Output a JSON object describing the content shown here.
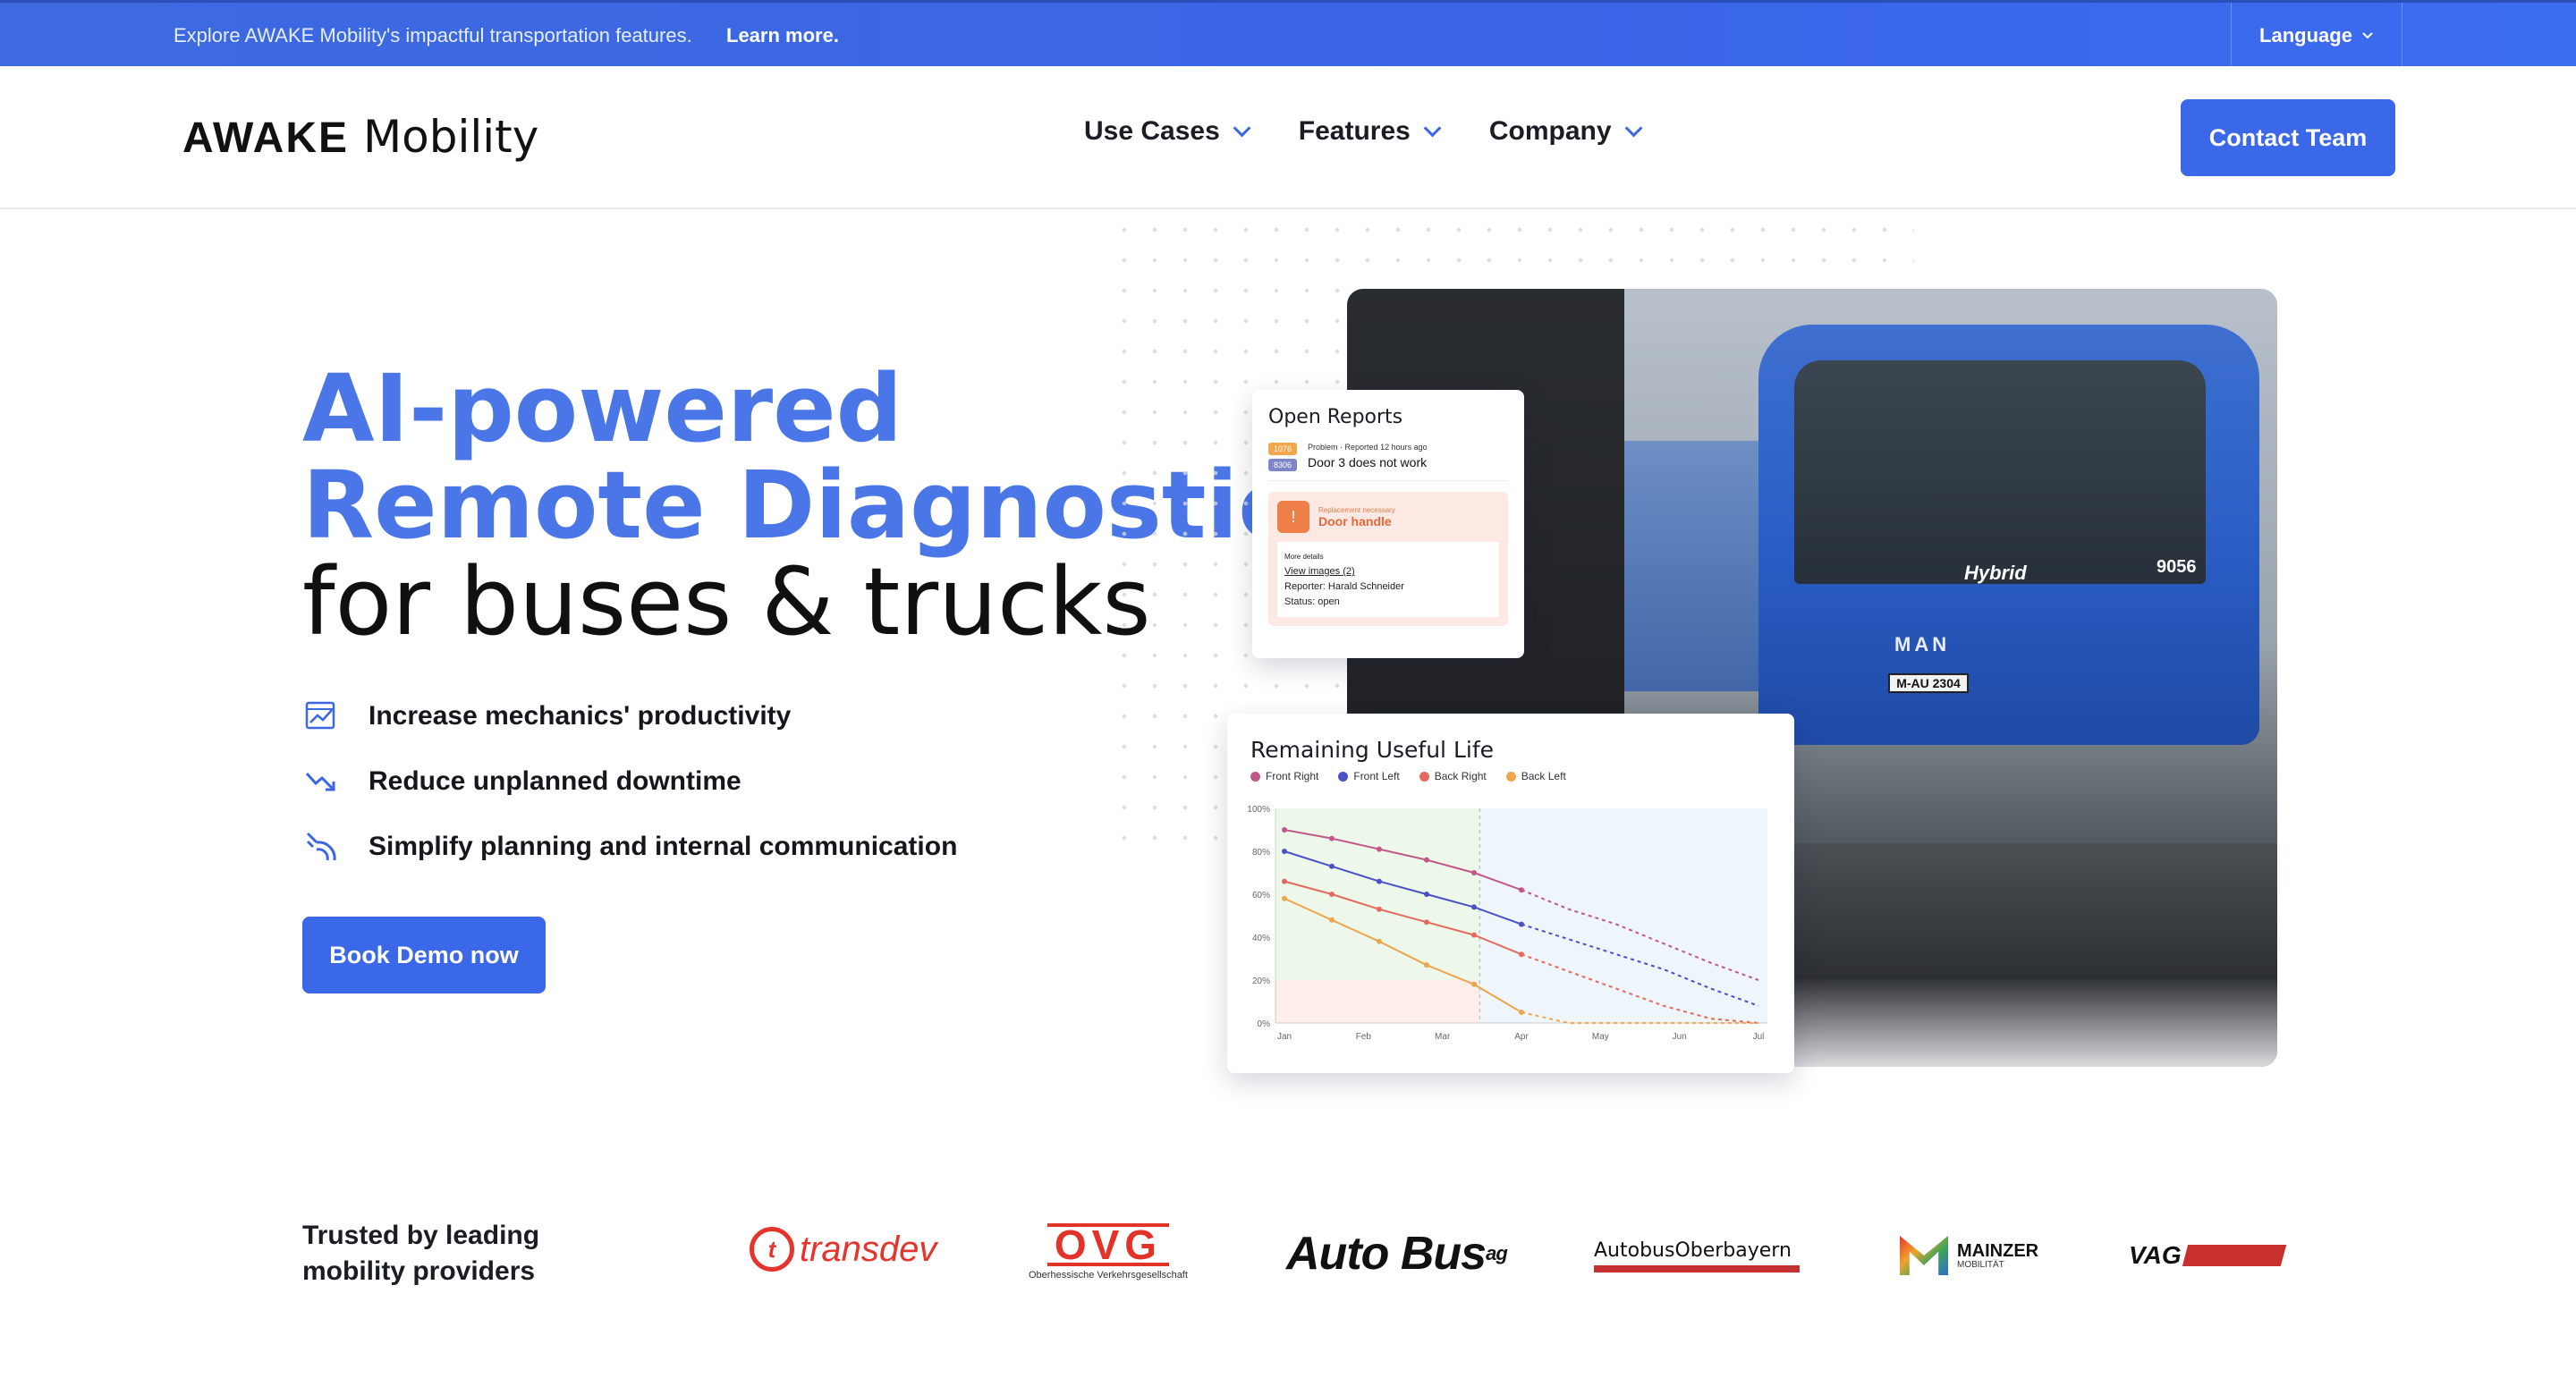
{
  "topbar": {
    "text": "Explore AWAKE Mobility's impactful transportation features.",
    "link": "Learn more.",
    "language": "Language"
  },
  "nav": {
    "logo_primary": "AWAKE",
    "logo_secondary": "Mobility",
    "items": [
      {
        "label": "Use Cases"
      },
      {
        "label": "Features"
      },
      {
        "label": "Company"
      }
    ],
    "cta": "Contact Team"
  },
  "hero": {
    "line1": "AI-powered",
    "line2": "Remote Diagnostics",
    "line3": "for buses & trucks",
    "bullets": [
      {
        "icon": "chart-line-icon",
        "label": "Increase mechanics' productivity"
      },
      {
        "icon": "trend-down-icon",
        "label": "Reduce unplanned downtime"
      },
      {
        "icon": "signal-icon",
        "label": "Simplify planning and internal communication"
      }
    ],
    "cta": "Book Demo now",
    "accent": "#4a76e8",
    "button_color": "#3b68e9"
  },
  "photo": {
    "hybrid": "Hybrid",
    "number": "9056",
    "brand": "MAN",
    "plate": "M-AU 2304"
  },
  "reports": {
    "title": "Open Reports",
    "tag1": "1076",
    "tag2": "8306",
    "meta": "Problem · Reported 12 hours ago",
    "problem": "Door 3 does not work",
    "alert_meta": "Replacement necessary",
    "alert_main": "Door handle",
    "details_label": "More details",
    "details_link": "View images (2)",
    "reporter": "Reporter: Harald Schneider",
    "status": "Status: open"
  },
  "rul": {
    "title": "Remaining Useful Life",
    "legend": [
      {
        "name": "Front Right",
        "color": "#c2588a"
      },
      {
        "name": "Front Left",
        "color": "#4a50c8"
      },
      {
        "name": "Back Right",
        "color": "#e46a5f"
      },
      {
        "name": "Back Left",
        "color": "#eda64b"
      }
    ]
  },
  "chart_data": {
    "type": "line",
    "title": "Remaining Useful Life",
    "x": [
      "Jan",
      "Feb",
      "Mar",
      "Apr",
      "May",
      "Jun",
      "Jul"
    ],
    "y_ticks": [
      "0%",
      "20%",
      "40%",
      "60%",
      "80%",
      "100%"
    ],
    "ylim": [
      0,
      100
    ],
    "legend_position": "top-left",
    "series": [
      {
        "name": "Front Right",
        "values": [
          90,
          86,
          81,
          76,
          70,
          62,
          53,
          46,
          37,
          28,
          20
        ]
      },
      {
        "name": "Front Left",
        "values": [
          80,
          73,
          66,
          60,
          54,
          46,
          39,
          32,
          25,
          16,
          8
        ]
      },
      {
        "name": "Back Right",
        "values": [
          66,
          60,
          53,
          47,
          41,
          32,
          24,
          16,
          8,
          2,
          0
        ]
      },
      {
        "name": "Back Left",
        "values": [
          58,
          48,
          38,
          27,
          18,
          5,
          0,
          0,
          0,
          0,
          0
        ]
      }
    ]
  },
  "trusted": {
    "line1": "Trusted by leading",
    "line2": "mobility providers",
    "logos": {
      "transdev": "transdev",
      "ovg": "OVG",
      "ovg_sub": "Oberhessische Verkehrsgesellschaft",
      "autobus": "Auto Bus",
      "autobus_sup": "ag",
      "abo": "AutobusOberbayern",
      "mainzer": "MAINZER",
      "mainzer_sub": "MOBILITÄT",
      "vag": "VAG"
    }
  }
}
